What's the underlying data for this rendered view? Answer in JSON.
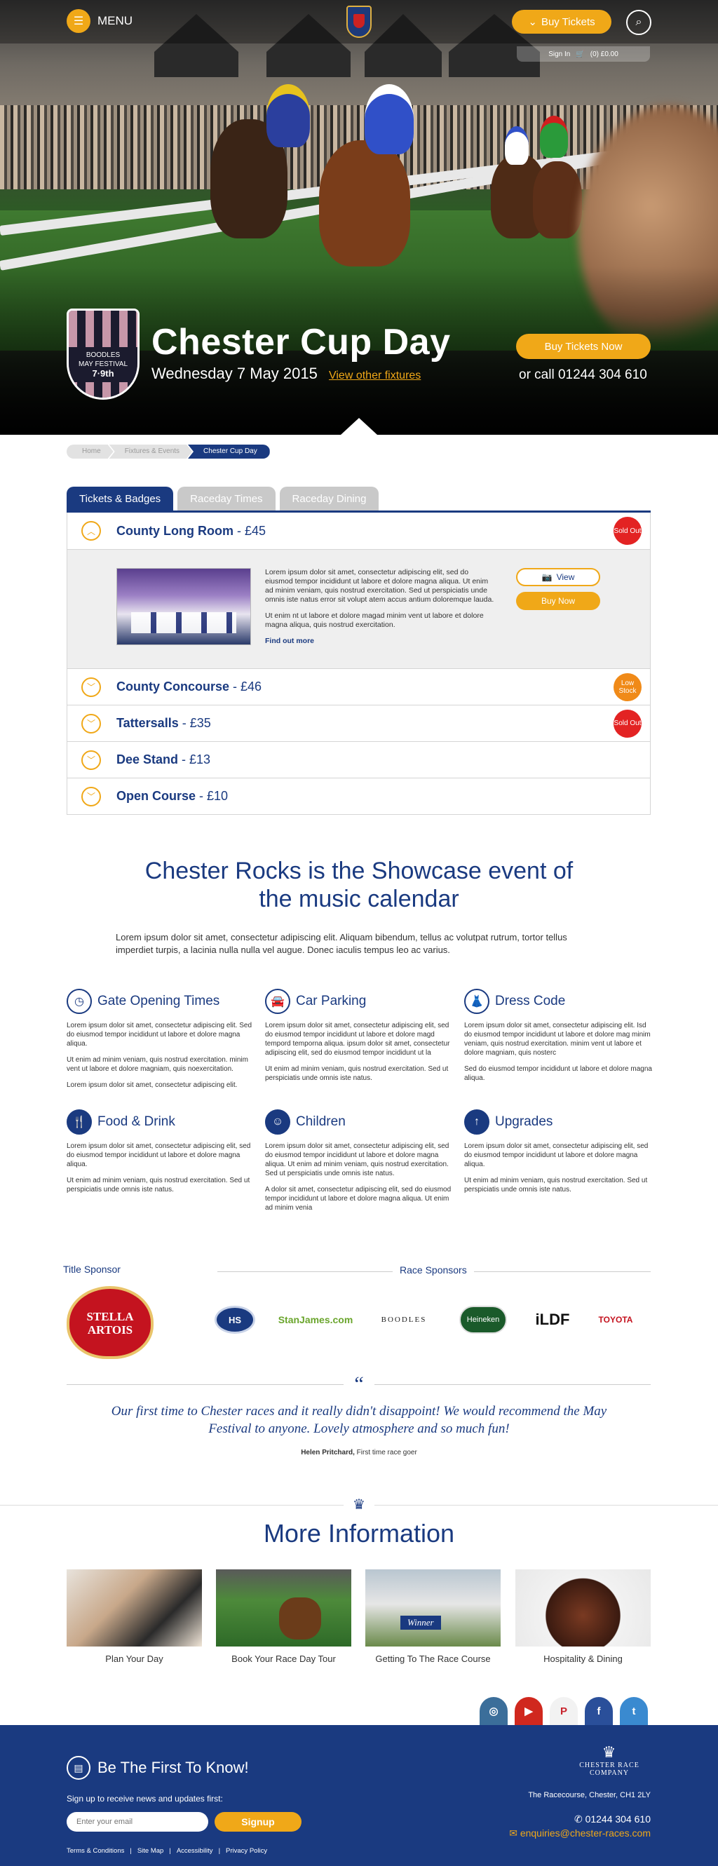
{
  "header": {
    "menu_label": "MENU",
    "buy_tickets": "Buy Tickets",
    "signin": "Sign In",
    "basket": "(0) £0.00"
  },
  "hero": {
    "title": "Chester Cup Day",
    "date": "Wednesday 7 May 2015",
    "fixtures_link": "View other fixtures",
    "buy_now": "Buy Tickets Now",
    "call": "or call 01244 304 610",
    "badge": {
      "brand": "BOODLES",
      "line2": "MAY FESTIVAL",
      "line3": "7·9th"
    }
  },
  "breadcrumb": [
    "Home",
    "Fixtures & Events",
    "Chester Cup Day"
  ],
  "tabs": [
    "Tickets & Badges",
    "Raceday Times",
    "Raceday Dining"
  ],
  "enclosures": [
    {
      "name": "County Long Room",
      "price": " - £45",
      "status": "Sold Out",
      "status_color": "#e32323"
    },
    {
      "name": "County Concourse",
      "price": " - £46",
      "status": "Low Stock",
      "status_color": "#f08a18"
    },
    {
      "name": "Tattersalls",
      "price": " - £35",
      "status": "Sold Out",
      "status_color": "#e32323"
    },
    {
      "name": "Dee Stand",
      "price": " - £13",
      "status": "",
      "status_color": ""
    },
    {
      "name": "Open Course",
      "price": " - £10",
      "status": "",
      "status_color": ""
    }
  ],
  "expanded": {
    "para1": "Lorem ipsum dolor sit amet, consectetur adipiscing elit, sed do eiusmod tempor incididunt ut labore et dolore magna aliqua. Ut enim ad minim veniam, quis nostrud exercitation. Sed ut perspiciatis unde omnis iste natus error sit volupt atem accus antium doloremque lauda.",
    "para2": "Ut enim nt ut labore et dolore magad minim vent ut labore et dolore magna aliqua, quis nostrud exercitation.",
    "find_out_more": "Find out more",
    "view": "View",
    "buy_now": "Buy Now"
  },
  "showcase": {
    "heading": "Chester Rocks is the Showcase event of the music calendar",
    "intro": "Lorem ipsum dolor sit amet, consectetur adipiscing elit. Aliquam bibendum, tellus ac volutpat rutrum, tortor tellus imperdiet turpis, a lacinia nulla nulla vel augue. Donec iaculis tempus leo ac varius."
  },
  "info": [
    {
      "title": "Gate Opening Times",
      "icon": "clock-icon",
      "paras": [
        "Lorem ipsum dolor sit amet, consectetur adipiscing elit. Sed do eiusmod tempor incididunt ut labore et dolore magna aliqua.",
        "Ut enim ad minim veniam, quis nostrud exercitation. minim vent ut labore et dolore magniam, quis noexercitation.",
        "Lorem ipsum dolor sit amet, consectetur adipiscing elit."
      ]
    },
    {
      "title": "Car Parking",
      "icon": "car-icon",
      "paras": [
        "Lorem ipsum dolor sit amet, consectetur adipiscing elit, sed do eiusmod tempor incididunt ut labore et dolore magd tempord temporna aliqua. ipsum dolor sit amet, consectetur adipiscing elit, sed do eiusmod tempor incididunt ut la",
        "Ut enim ad minim veniam, quis nostrud exercitation. Sed ut perspiciatis unde omnis iste natus."
      ]
    },
    {
      "title": "Dress Code",
      "icon": "dress-icon",
      "paras": [
        "Lorem ipsum dolor sit amet, consectetur adipiscing elit. Isd do eiusmod tempor incididunt ut labore et dolore mag minim veniam, quis nostrud exercitation. minim vent ut labore et dolore magniam, quis nosterc",
        "Sed do eiusmod tempor incididunt ut labore et dolore magna aliqua."
      ]
    },
    {
      "title": "Food & Drink",
      "icon": "cutlery-icon",
      "paras": [
        "Lorem ipsum dolor sit amet, consectetur adipiscing elit, sed do eiusmod tempor incididunt ut labore et dolore magna aliqua.",
        "Ut enim ad minim veniam, quis nostrud exercitation. Sed ut perspiciatis unde omnis iste natus."
      ]
    },
    {
      "title": "Children",
      "icon": "child-icon",
      "paras": [
        "Lorem ipsum dolor sit amet, consectetur adipiscing elit, sed do eiusmod tempor incididunt ut labore et dolore magna aliqua. Ut enim ad minim veniam, quis nostrud exercitation. Sed ut perspiciatis unde omnis iste natus.",
        "A dolor sit amet, consectetur adipiscing elit, sed do eiusmod tempor incididunt ut labore et dolore magna aliqua. Ut enim ad minim venia"
      ]
    },
    {
      "title": "Upgrades",
      "icon": "arrow-up-icon",
      "paras": [
        "Lorem ipsum dolor sit amet, consectetur adipiscing elit, sed do eiusmod tempor incididunt ut labore et dolore magna aliqua.",
        "Ut enim ad minim veniam, quis nostrud exercitation. Sed ut perspiciatis unde omnis iste natus."
      ]
    }
  ],
  "sponsors": {
    "title_label": "Title Sponsor",
    "title_sponsor": "STELLA ARTOIS",
    "race_label": "Race Sponsors",
    "race": [
      "HS",
      "StanJames.com",
      "BOODLES",
      "Heineken",
      "iLDF",
      "TOYOTA"
    ]
  },
  "testimonial": {
    "quote": "Our first time to Chester races and it really didn't disappoint! We would recommend the May Festival to anyone. Lovely atmosphere and so much fun!",
    "author": "Helen Pritchard,",
    "role": " First time race goer"
  },
  "more": {
    "heading": "More Information",
    "cards": [
      "Plan Your Day",
      "Book Your Race Day Tour",
      "Getting To The Race Course",
      "Hospitality & Dining"
    ],
    "winner_label": "Winner"
  },
  "social": [
    "instagram-icon",
    "youtube-icon",
    "pinterest-icon",
    "facebook-icon",
    "twitter-icon"
  ],
  "footer": {
    "heading": "Be The First To Know!",
    "sub": "Sign up to receive news and updates first:",
    "placeholder": "Enter your email",
    "signup": "Signup",
    "links": [
      "Terms & Conditions",
      "Site Map",
      "Accessibility",
      "Privacy Policy"
    ],
    "logo": "CHESTER RACE COMPANY",
    "address": "The Racecourse, Chester, CH1 2LY",
    "phone": "01244 304 610",
    "email": "enquiries@chester-races.com"
  },
  "colors": {
    "navy": "#1a3a80",
    "gold": "#f0a818",
    "sold_out": "#e32323",
    "low_stock": "#f08a18"
  }
}
